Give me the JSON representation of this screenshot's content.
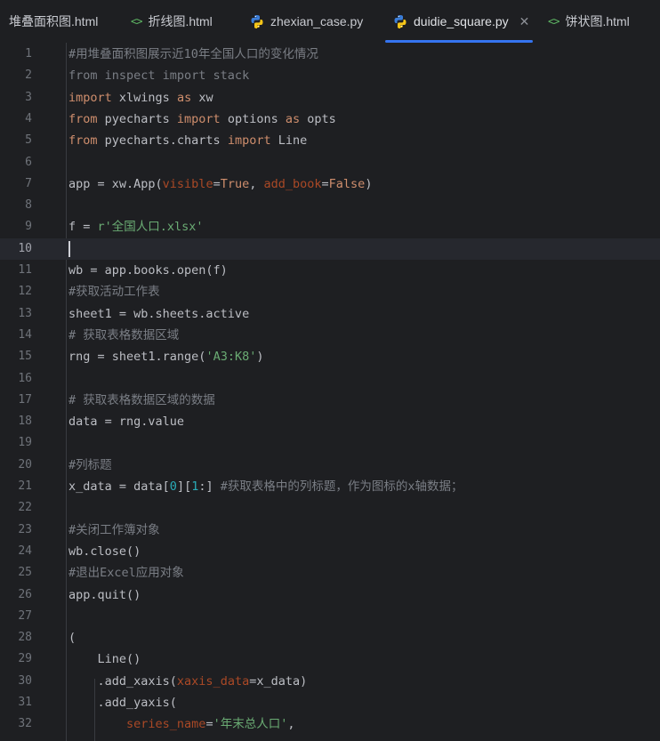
{
  "tabs": [
    {
      "label": "堆叠面积图.html",
      "icon": "html-icon",
      "active": false,
      "close": ""
    },
    {
      "label": "折线图.html",
      "icon": "html-icon",
      "active": false,
      "close": ""
    },
    {
      "label": "zhexian_case.py",
      "icon": "python-icon",
      "active": false,
      "close": ""
    },
    {
      "label": "duidie_square.py",
      "icon": "python-icon",
      "active": true,
      "close": "✕"
    },
    {
      "label": "饼状图.html",
      "icon": "html-icon",
      "active": false,
      "close": ""
    }
  ],
  "html_icon_glyph": "<>",
  "current_line": 10,
  "lines": [
    {
      "n": "1",
      "tokens": [
        [
          "cm",
          "#用堆叠面积图展示近10年全国人口的变化情况"
        ]
      ]
    },
    {
      "n": "2",
      "tokens": [
        [
          "cm",
          "from inspect import stack"
        ]
      ]
    },
    {
      "n": "3",
      "tokens": [
        [
          "kw",
          "import"
        ],
        [
          "",
          " xlwings "
        ],
        [
          "kw",
          "as"
        ],
        [
          "",
          " xw"
        ]
      ]
    },
    {
      "n": "4",
      "tokens": [
        [
          "kw",
          "from"
        ],
        [
          "",
          " pyecharts "
        ],
        [
          "kw",
          "import"
        ],
        [
          "",
          " options "
        ],
        [
          "kw",
          "as"
        ],
        [
          "",
          " opts"
        ]
      ]
    },
    {
      "n": "5",
      "tokens": [
        [
          "kw",
          "from"
        ],
        [
          "",
          " pyecharts.charts "
        ],
        [
          "kw",
          "import"
        ],
        [
          "",
          " Line"
        ]
      ]
    },
    {
      "n": "6",
      "tokens": []
    },
    {
      "n": "7",
      "tokens": [
        [
          "",
          "app = xw.App("
        ],
        [
          "pm",
          "visible"
        ],
        [
          "",
          "="
        ],
        [
          "cn",
          "True"
        ],
        [
          "",
          ", "
        ],
        [
          "pm",
          "add_book"
        ],
        [
          "",
          "="
        ],
        [
          "cn",
          "False"
        ],
        [
          "",
          ")"
        ]
      ]
    },
    {
      "n": "8",
      "tokens": []
    },
    {
      "n": "9",
      "tokens": [
        [
          "",
          "f = "
        ],
        [
          "st",
          "r'全国人口.xlsx'"
        ]
      ]
    },
    {
      "n": "10",
      "tokens": []
    },
    {
      "n": "11",
      "tokens": [
        [
          "",
          "wb = app.books.open(f)"
        ]
      ]
    },
    {
      "n": "12",
      "tokens": [
        [
          "cm",
          "#获取活动工作表"
        ]
      ]
    },
    {
      "n": "13",
      "tokens": [
        [
          "",
          "sheet1 = wb.sheets.active"
        ]
      ]
    },
    {
      "n": "14",
      "tokens": [
        [
          "cm",
          "# 获取表格数据区域"
        ]
      ]
    },
    {
      "n": "15",
      "tokens": [
        [
          "",
          "rng = sheet1.range("
        ],
        [
          "st",
          "'A3:K8'"
        ],
        [
          "",
          ")"
        ]
      ]
    },
    {
      "n": "16",
      "tokens": []
    },
    {
      "n": "17",
      "tokens": [
        [
          "cm",
          "# 获取表格数据区域的数据"
        ]
      ]
    },
    {
      "n": "18",
      "tokens": [
        [
          "",
          "data = rng.value"
        ]
      ]
    },
    {
      "n": "19",
      "tokens": []
    },
    {
      "n": "20",
      "tokens": [
        [
          "cm",
          "#列标题"
        ]
      ]
    },
    {
      "n": "21",
      "tokens": [
        [
          "",
          "x_data = data["
        ],
        [
          "nm",
          "0"
        ],
        [
          "",
          "]["
        ],
        [
          "nm",
          "1"
        ],
        [
          "",
          ":] "
        ],
        [
          "cm",
          "#获取表格中的列标题，作为图标的x轴数据；"
        ]
      ]
    },
    {
      "n": "22",
      "tokens": []
    },
    {
      "n": "23",
      "tokens": [
        [
          "cm",
          "#关闭工作簿对象"
        ]
      ]
    },
    {
      "n": "24",
      "tokens": [
        [
          "",
          "wb.close()"
        ]
      ]
    },
    {
      "n": "25",
      "tokens": [
        [
          "cm",
          "#退出Excel应用对象"
        ]
      ]
    },
    {
      "n": "26",
      "tokens": [
        [
          "",
          "app.quit()"
        ]
      ]
    },
    {
      "n": "27",
      "tokens": []
    },
    {
      "n": "28",
      "tokens": [
        [
          "",
          "("
        ]
      ]
    },
    {
      "n": "29",
      "tokens": [
        [
          "",
          "    Line()"
        ]
      ]
    },
    {
      "n": "30",
      "tokens": [
        [
          "",
          "    .add_xaxis("
        ],
        [
          "pm",
          "xaxis_data"
        ],
        [
          "",
          "=x_data)"
        ]
      ]
    },
    {
      "n": "31",
      "tokens": [
        [
          "",
          "    .add_yaxis("
        ]
      ]
    },
    {
      "n": "32",
      "tokens": [
        [
          "",
          "        "
        ],
        [
          "pm",
          "series_name"
        ],
        [
          "",
          "="
        ],
        [
          "st",
          "'年末总人口'"
        ],
        [
          "",
          ","
        ]
      ]
    }
  ]
}
